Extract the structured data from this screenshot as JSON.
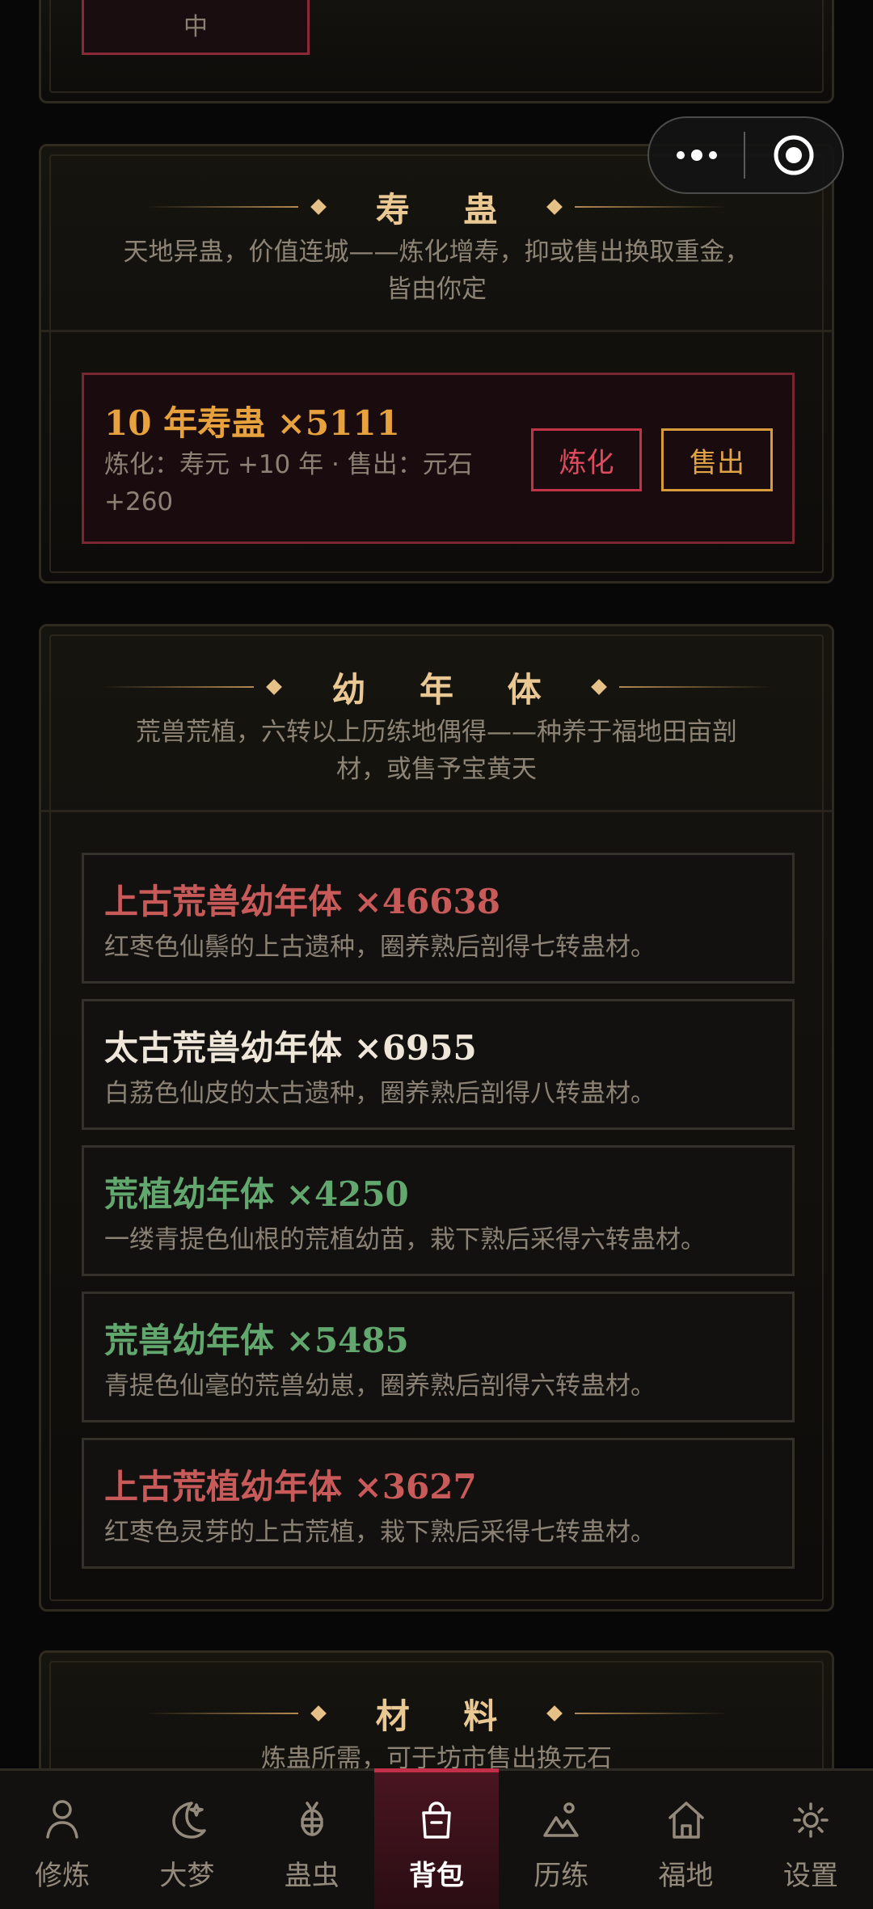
{
  "top_panel": {
    "button_label": "中"
  },
  "capsule": {
    "more_icon": "more-dots-icon",
    "close_icon": "target-icon"
  },
  "shougu": {
    "title": "寿 蛊",
    "subtitle": "天地异蛊，价值连城——炼化增寿，抑或售出换取重金，皆由你定",
    "item": {
      "name": "10 年寿蛊",
      "count": "×5111",
      "desc": "炼化：寿元 +10 年 · 售出：元石 +260",
      "refine_label": "炼化",
      "sell_label": "售出",
      "name_color": "#e8a23d"
    }
  },
  "younian": {
    "title": "幼 年 体",
    "subtitle": "荒兽荒植，六转以上历练地偶得——种养于福地田亩剖材，或售予宝黄天",
    "items": [
      {
        "name": "上古荒兽幼年体",
        "count": "×46638",
        "desc": "红枣色仙鬃的上古遗种，圈养熟后剖得七转蛊材。",
        "color": "#c95a5a"
      },
      {
        "name": "太古荒兽幼年体",
        "count": "×6955",
        "desc": "白荔色仙皮的太古遗种，圈养熟后剖得八转蛊材。",
        "color": "#eee6d8"
      },
      {
        "name": "荒植幼年体",
        "count": "×4250",
        "desc": "一缕青提色仙根的荒植幼苗，栽下熟后采得六转蛊材。",
        "color": "#62a86e"
      },
      {
        "name": "荒兽幼年体",
        "count": "×5485",
        "desc": "青提色仙毫的荒兽幼崽，圈养熟后剖得六转蛊材。",
        "color": "#62a86e"
      },
      {
        "name": "上古荒植幼年体",
        "count": "×3627",
        "desc": "红枣色灵芽的上古荒植，栽下熟后采得七转蛊材。",
        "color": "#c95a5a"
      }
    ]
  },
  "cailiao": {
    "title": "材 料",
    "subtitle": "炼蛊所需，可于坊市售出换元石"
  },
  "tabbar": {
    "tabs": [
      {
        "label": "修炼",
        "icon": "person-icon"
      },
      {
        "label": "大梦",
        "icon": "moon-icon"
      },
      {
        "label": "蛊虫",
        "icon": "bug-icon"
      },
      {
        "label": "背包",
        "icon": "bag-icon",
        "active": true
      },
      {
        "label": "历练",
        "icon": "mountain-icon"
      },
      {
        "label": "福地",
        "icon": "home-icon"
      },
      {
        "label": "设置",
        "icon": "gear-icon"
      }
    ]
  }
}
